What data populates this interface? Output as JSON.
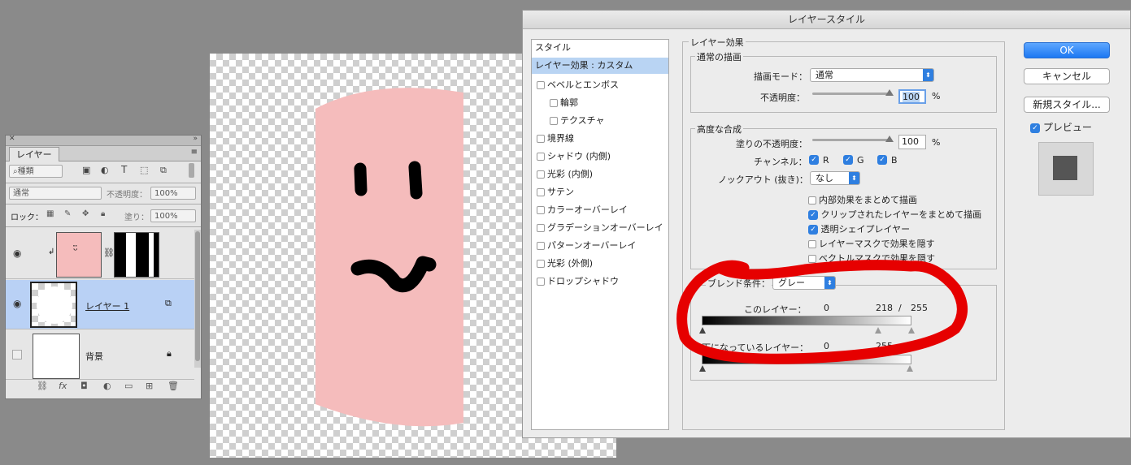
{
  "colors": {
    "skin": "#f5bcbc",
    "accent": "#2f7fe0",
    "annotation": "#e60000",
    "selected_layer": "#b9d1f5"
  },
  "layers_panel": {
    "tab": "レイヤー",
    "filter_kind": "種類",
    "blend_mode": "通常",
    "opacity_label": "不透明度：",
    "opacity_value": "100%",
    "lock_label": "ロック：",
    "fill_label": "塗り：",
    "fill_value": "100%",
    "layers": [
      {
        "name": "",
        "visible": true
      },
      {
        "name": "レイヤー 1",
        "visible": true
      },
      {
        "name": "背景",
        "visible": false
      }
    ]
  },
  "dialog": {
    "title": "レイヤースタイル",
    "styles_header": "スタイル",
    "styles": [
      {
        "label": "レイヤー効果 : カスタム",
        "selected": true,
        "checkbox": false
      },
      {
        "label": "ベベルとエンボス",
        "checkbox": true
      },
      {
        "label": "輪郭",
        "checkbox": true,
        "indent": true
      },
      {
        "label": "テクスチャ",
        "checkbox": true,
        "indent": true
      },
      {
        "label": "境界線",
        "checkbox": true
      },
      {
        "label": "シャドウ (内側)",
        "checkbox": true
      },
      {
        "label": "光彩 (内側)",
        "checkbox": true
      },
      {
        "label": "サテン",
        "checkbox": true
      },
      {
        "label": "カラーオーバーレイ",
        "checkbox": true
      },
      {
        "label": "グラデーションオーバーレイ",
        "checkbox": true
      },
      {
        "label": "パターンオーバーレイ",
        "checkbox": true
      },
      {
        "label": "光彩 (外側)",
        "checkbox": true
      },
      {
        "label": "ドロップシャドウ",
        "checkbox": true
      }
    ],
    "effects_group": "レイヤー効果",
    "normal_group": "通常の描画",
    "blend_mode_label": "描画モード：",
    "blend_mode_value": "通常",
    "opacity_label": "不透明度：",
    "opacity_value": "100",
    "opacity_unit": "%",
    "advanced_group": "高度な合成",
    "fill_opacity_label": "塗りの不透明度：",
    "fill_opacity_value": "100",
    "fill_opacity_unit": "%",
    "channels_label": "チャンネル：",
    "channel_r": "R",
    "channel_g": "G",
    "channel_b": "B",
    "knockout_label": "ノックアウト (抜き)：",
    "knockout_value": "なし",
    "options": [
      {
        "label": "内部効果をまとめて描画",
        "checked": false
      },
      {
        "label": "クリップされたレイヤーをまとめて描画",
        "checked": true
      },
      {
        "label": "透明シェイプレイヤー",
        "checked": true
      },
      {
        "label": "レイヤーマスクで効果を隠す",
        "checked": false
      },
      {
        "label": "ベクトルマスクで効果を隠す",
        "checked": false
      }
    ],
    "blend_if_label": "ブレンド条件：",
    "blend_if_value": "グレー",
    "this_layer_label": "このレイヤー：",
    "this_layer_min": "0",
    "this_layer_max": "218",
    "this_layer_sep": "/",
    "this_layer_max2": "255",
    "underlying_label": "下になっているレイヤー：",
    "underlying_min": "0",
    "underlying_max": "255",
    "ok": "OK",
    "cancel": "キャンセル",
    "new_style": "新規スタイル...",
    "preview": "プレビュー"
  }
}
